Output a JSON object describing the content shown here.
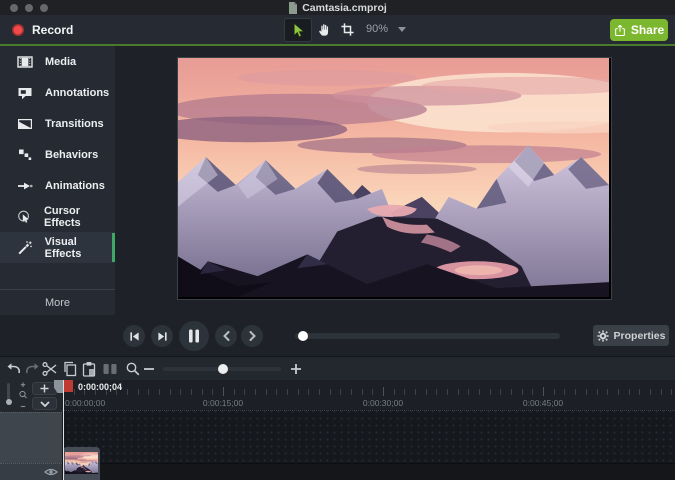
{
  "window": {
    "title": "Camtasia.cmproj"
  },
  "toolbar": {
    "record_label": "Record",
    "zoom_level": "90%",
    "share_label": "Share"
  },
  "sidebar": {
    "items": [
      {
        "label": "Media",
        "icon": "media-icon",
        "selected": false
      },
      {
        "label": "Annotations",
        "icon": "annotations-icon",
        "selected": false
      },
      {
        "label": "Transitions",
        "icon": "transitions-icon",
        "selected": false
      },
      {
        "label": "Behaviors",
        "icon": "behaviors-icon",
        "selected": false
      },
      {
        "label": "Animations",
        "icon": "animations-icon",
        "selected": false
      },
      {
        "label": "Cursor Effects",
        "icon": "cursor-effects-icon",
        "selected": false
      },
      {
        "label": "Visual Effects",
        "icon": "visual-effects-icon",
        "selected": true
      }
    ],
    "more_label": "More"
  },
  "preview": {
    "content_description": "snowy mountain valley at pink sunset"
  },
  "playback": {
    "properties_label": "Properties",
    "progress_percent": 3
  },
  "timeline_toolbar": {
    "zoom_percent": 51
  },
  "timeline": {
    "playhead_timecode": "0:00:00;04",
    "ruler_labels": [
      "0:00:00;00",
      "0:00:15;00",
      "0:00:30;00",
      "0:00:45;00"
    ]
  },
  "colors": {
    "accent_green": "#7cb82f",
    "toolbar_rule_green": "#4a7a2c",
    "selection_green": "#3ea766",
    "record_red": "#ee4a4a",
    "playhead_red": "#bf3a32"
  }
}
